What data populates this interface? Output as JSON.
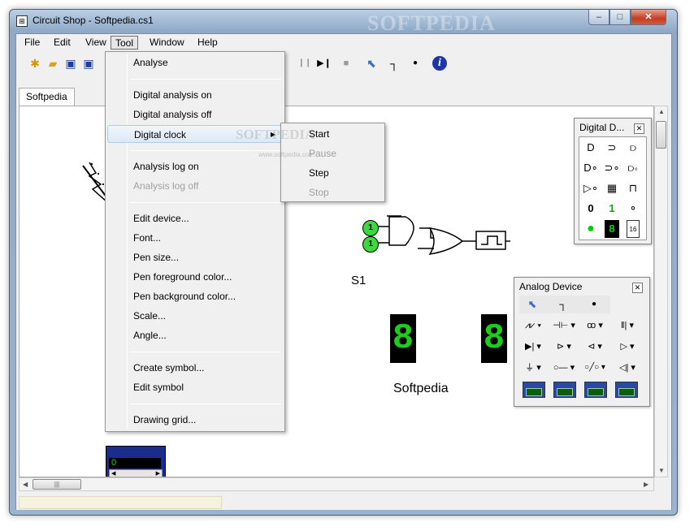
{
  "window": {
    "title": "Circuit Shop - Softpedia.cs1",
    "watermark": "SOFTPEDIA",
    "controls": {
      "minimize": "–",
      "maximize": "□",
      "close": "✕"
    },
    "app_icon": "circuit-app-icon"
  },
  "menubar": [
    "File",
    "Edit",
    "View",
    "Tool",
    "Window",
    "Help"
  ],
  "toolbar": {
    "icons": [
      "new-file-icon",
      "open-folder-icon",
      "save-icon",
      "save-all-icon",
      "pause-icon",
      "step-icon",
      "stop-icon",
      "pointer-icon",
      "wire-icon",
      "junction-icon",
      "help-icon"
    ],
    "glyphs": {
      "new": "✱",
      "open": "📂",
      "save": "▣",
      "saveall": "▣",
      "pause": "❙❙",
      "step": "▶❙",
      "stop": "■",
      "pointer": "⬉",
      "wire": "┐",
      "junction": "●",
      "help": "i"
    }
  },
  "tab": "Softpedia",
  "tool_menu": {
    "items": [
      {
        "label": "Analyse",
        "enabled": true
      },
      {
        "label": "Digital analysis on",
        "enabled": true
      },
      {
        "label": "Digital analysis off",
        "enabled": true
      },
      {
        "label": "Digital clock",
        "enabled": true,
        "submenu": true,
        "highlighted": true
      },
      {
        "label": "Analysis log on",
        "enabled": true
      },
      {
        "label": "Analysis log off",
        "enabled": false
      },
      {
        "label": "Edit device...",
        "enabled": true
      },
      {
        "label": "Font...",
        "enabled": true
      },
      {
        "label": "Pen size...",
        "enabled": true
      },
      {
        "label": "Pen foreground color...",
        "enabled": true
      },
      {
        "label": "Pen background color...",
        "enabled": true
      },
      {
        "label": "Scale...",
        "enabled": true
      },
      {
        "label": "Angle...",
        "enabled": true
      },
      {
        "label": "Create symbol...",
        "enabled": true
      },
      {
        "label": "Edit symbol",
        "enabled": true
      },
      {
        "label": "Drawing grid...",
        "enabled": true
      }
    ]
  },
  "clock_submenu": {
    "items": [
      {
        "label": "Start",
        "enabled": true
      },
      {
        "label": "Pause",
        "enabled": false
      },
      {
        "label": "Step",
        "enabled": true
      },
      {
        "label": "Stop",
        "enabled": false
      }
    ]
  },
  "canvas": {
    "label_s1": "S1",
    "label_softpedia": "Softpedia",
    "led1": "1",
    "led2": "1",
    "digit1": "8",
    "digit2": "8",
    "counter_value": "0",
    "menu_watermark": "SOFTPEDIA",
    "menu_watermark_sub": "www.softpedia.com"
  },
  "digital_panel": {
    "title": "Digital D...",
    "close": "✕",
    "rows": [
      [
        "and-gate-icon",
        "or-gate-icon",
        "xor-gate-icon"
      ],
      [
        "nand-gate-icon",
        "nor-gate-icon",
        "xnor-gate-icon"
      ],
      [
        "buffer-icon",
        "chip-icon",
        "pulse-icon"
      ],
      [
        "zero-input-icon",
        "one-input-icon",
        "switch-icon"
      ],
      [
        "led-icon",
        "seven-segment-icon",
        "hex-display-icon"
      ]
    ],
    "labels": {
      "zero": "0",
      "one": "1",
      "hex": "16",
      "seg": "8"
    }
  },
  "analog_panel": {
    "title": "Analog Device",
    "close": "✕",
    "rows": [
      [
        "resistor-icon",
        "capacitor-icon",
        "inductor-icon",
        "battery-icon"
      ],
      [
        "diode-icon",
        "npn-transistor-icon",
        "pnp-transistor-icon",
        "opamp-icon"
      ],
      [
        "ground-icon",
        "terminal-icon",
        "switch-icon",
        "speaker-icon"
      ],
      [
        "voltmeter-icon",
        "ammeter-icon",
        "ohmmeter-icon",
        "wattmeter-icon"
      ]
    ],
    "glyphs": [
      "⩘⩗",
      "⊣⊢",
      "ꝏ",
      "‖|",
      "▶|",
      "⊳",
      "⊲",
      "▷",
      "⏚",
      "○—",
      "○╱○",
      "◁|"
    ],
    "dropdown": "▾",
    "top_tools": [
      "pointer-icon",
      "wire-icon",
      "junction-icon"
    ]
  },
  "scroll": {
    "up": "▲",
    "down": "▼",
    "left": "◀",
    "right": "▶",
    "grip": "|||"
  }
}
